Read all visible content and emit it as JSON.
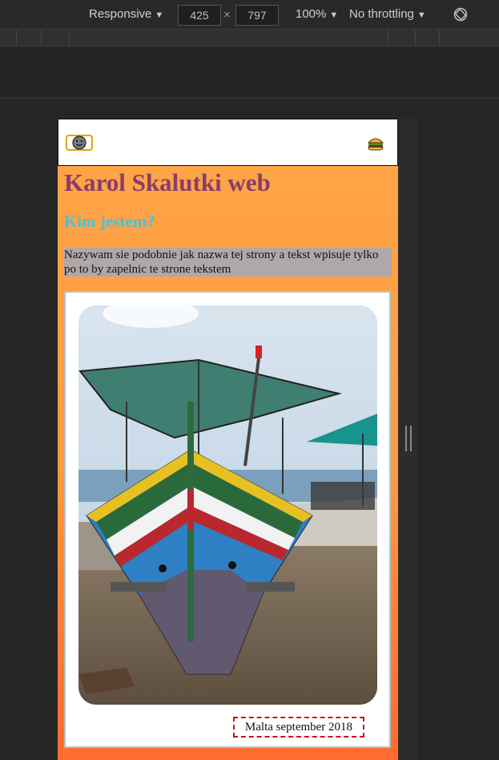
{
  "devtools": {
    "device": "Responsive",
    "width": "425",
    "times": "×",
    "height": "797",
    "zoom": "100%",
    "throttling": "No throttling",
    "caret": "▼"
  },
  "page": {
    "title": "Karol Skalutki web",
    "subtitle": "Kim jestem?",
    "intro": "Nazywam sie podobnie jak nazwa tej strony a tekst wpisuje tylko po to by zapelnic te strone tekstem",
    "caption": "Malta september 2018"
  },
  "colors": {
    "title": "#8a3d68",
    "subtitle": "#4fc1d3",
    "intro_bg": "#b0a8a8",
    "gradient_top": "#ffa447",
    "gradient_bottom": "#ff6a30",
    "caption_border": "#cc1111"
  },
  "icons": {
    "logo": "smiley-face-icon",
    "menu": "burger-icon",
    "rotate": "rotate-icon"
  }
}
